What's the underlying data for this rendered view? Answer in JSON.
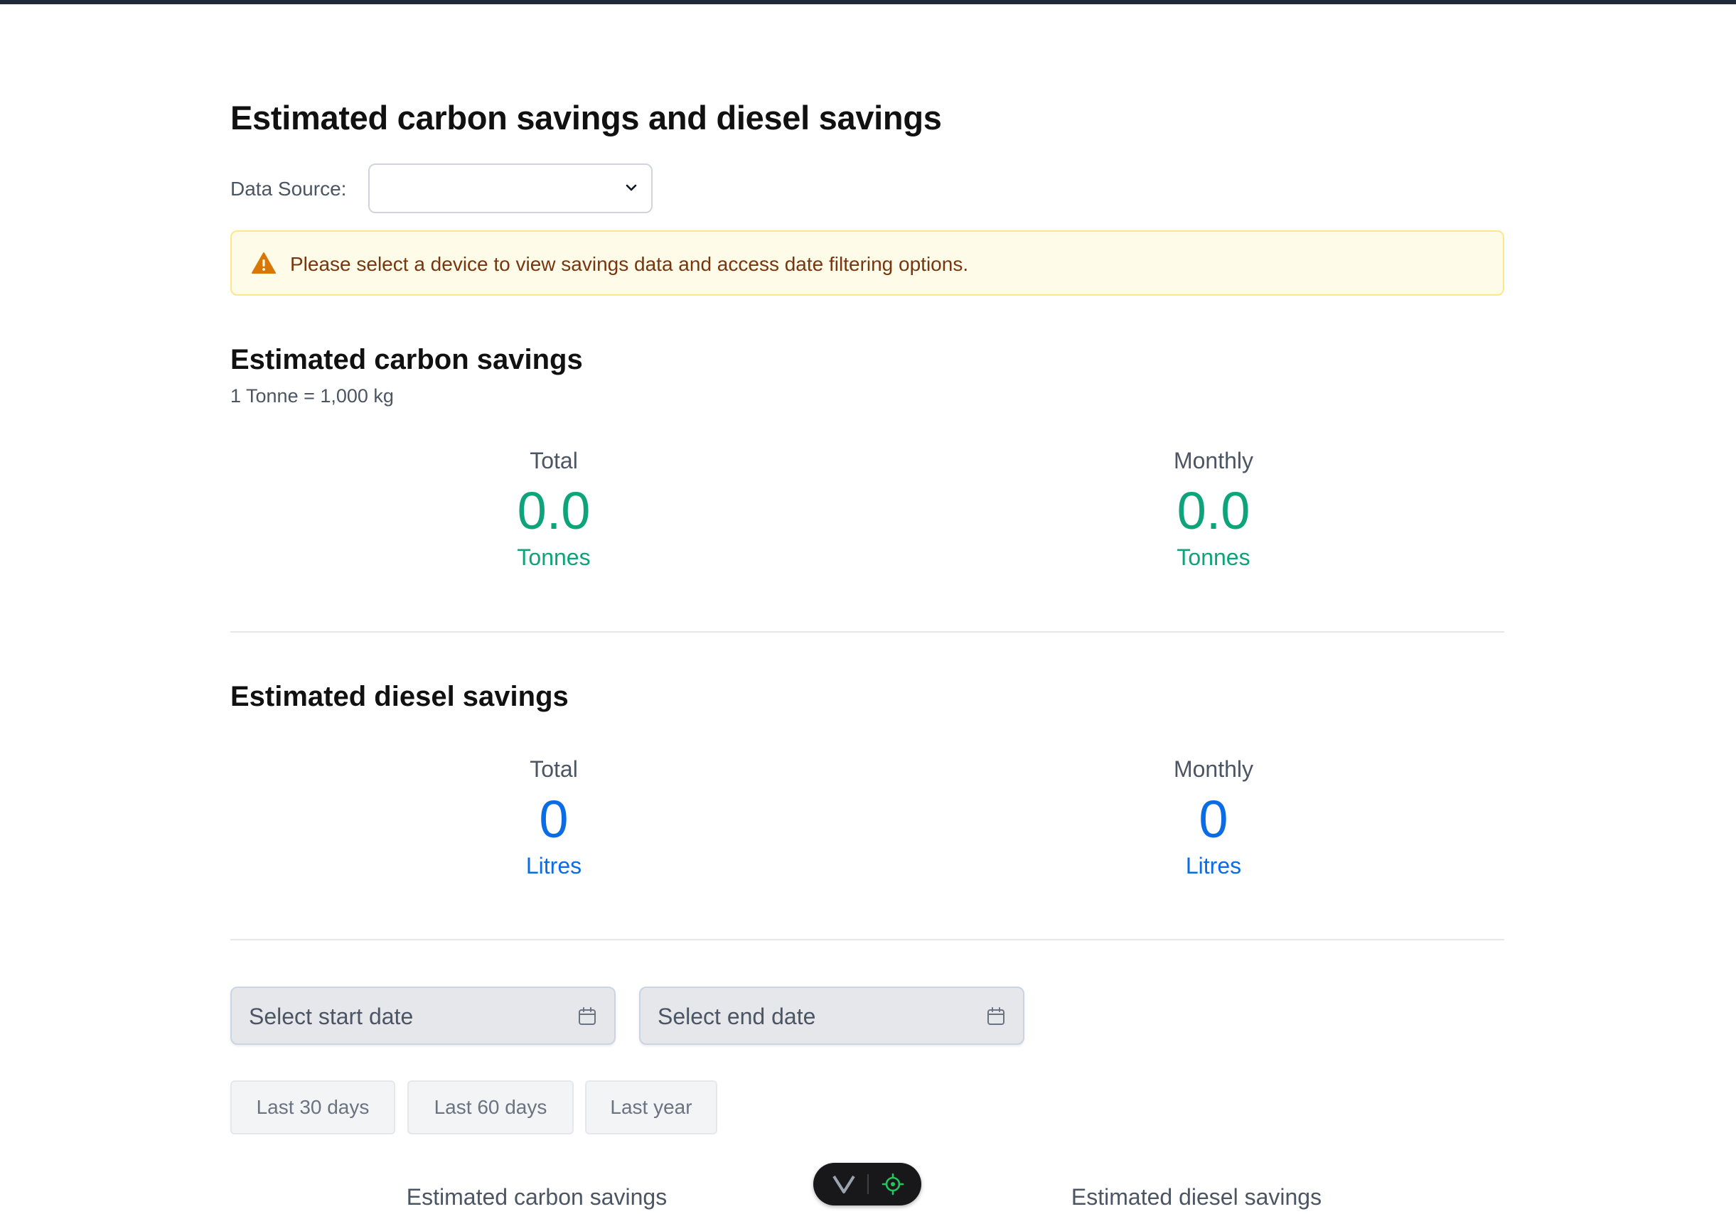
{
  "page": {
    "title": "Estimated carbon savings and diesel savings"
  },
  "data_source": {
    "label": "Data Source:",
    "selected": ""
  },
  "alert": {
    "message": "Please select a device to view savings data and access date filtering options.",
    "icon": "warning-triangle-icon"
  },
  "carbon": {
    "title": "Estimated carbon savings",
    "note": "1 Tonne = 1,000 kg",
    "total": {
      "label": "Total",
      "value": "0.0",
      "unit": "Tonnes"
    },
    "monthly": {
      "label": "Monthly",
      "value": "0.0",
      "unit": "Tonnes"
    }
  },
  "diesel": {
    "title": "Estimated diesel savings",
    "total": {
      "label": "Total",
      "value": "0",
      "unit": "Litres"
    },
    "monthly": {
      "label": "Monthly",
      "value": "0",
      "unit": "Litres"
    }
  },
  "date_filter": {
    "start_placeholder": "Select start date",
    "end_placeholder": "Select end date",
    "quick_ranges": [
      "Last 30 days",
      "Last 60 days",
      "Last year"
    ]
  },
  "charts": {
    "carbon_label": "Estimated carbon savings",
    "diesel_label": "Estimated diesel savings"
  },
  "colors": {
    "carbon_accent": "#0ea47a",
    "diesel_accent": "#0b6ce6",
    "warning": "#d97706"
  }
}
